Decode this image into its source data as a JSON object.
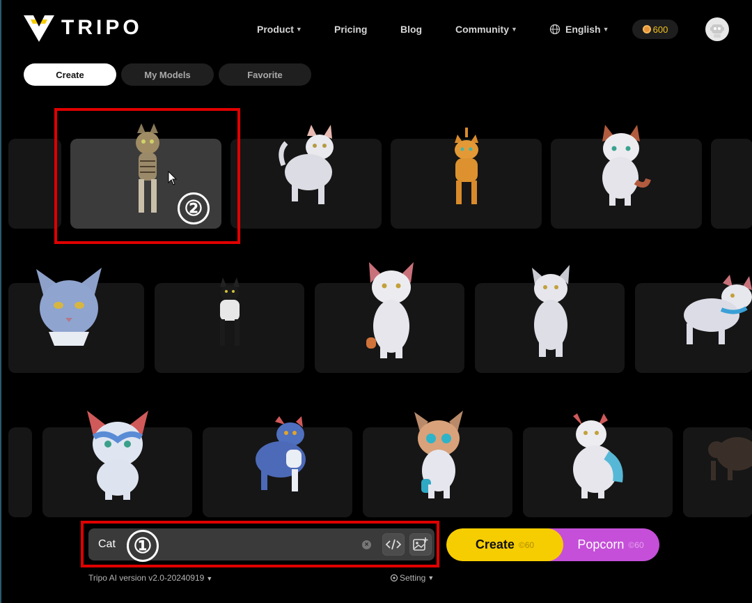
{
  "app": {
    "brand": "TRIPO",
    "accent": "#f6cd00",
    "popcorn_color": "#c54fd9",
    "highlight_color": "#e00000"
  },
  "nav": {
    "product": "Product",
    "pricing": "Pricing",
    "blog": "Blog",
    "community": "Community",
    "language": "English",
    "credits": "600"
  },
  "tabs": {
    "create": "Create",
    "my_models": "My Models",
    "favorite": "Favorite"
  },
  "gallery": {
    "rows": [
      [
        "tabby-cat",
        "white-cat",
        "orange-cat",
        "calico-cat"
      ],
      [
        "blue-cat-head",
        "black-white-cat",
        "white-orange-cat",
        "grey-white-cat",
        "blue-collar-cat"
      ],
      [
        "blue-white-cat",
        "blue-cat",
        "teal-calico-cat",
        "white-teal-cat",
        "dark-cat"
      ]
    ],
    "selected": "tabby-cat"
  },
  "annotations": {
    "step1": "①",
    "step2": "②"
  },
  "prompt": {
    "value": "Cat",
    "placeholder": ""
  },
  "actions": {
    "create_label": "Create",
    "create_cost": "60",
    "popcorn_label": "Popcorn",
    "popcorn_cost": "60"
  },
  "footer": {
    "version": "Tripo AI version v2.0-20240919",
    "setting": "Setting"
  }
}
